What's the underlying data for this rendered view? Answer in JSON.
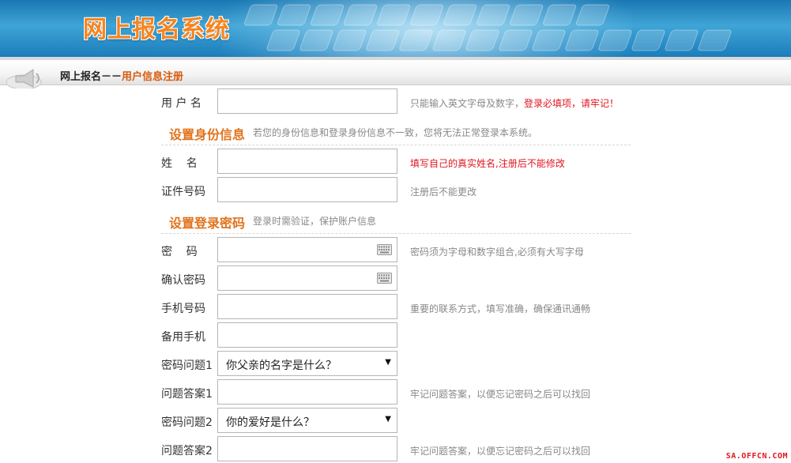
{
  "header": {
    "logo_text": "网上报名系统"
  },
  "breadcrumb": {
    "root": "网上报名－－",
    "current": "用户信息注册"
  },
  "form": {
    "username": {
      "label": "用 户 名",
      "hint": "只能输入英文字母及数字，",
      "hint_red": "登录必填项，请牢记！"
    },
    "identity_section": {
      "title": "设置身份信息",
      "note": "若您的身份信息和登录身份信息不一致，您将无法正常登录本系统。"
    },
    "name": {
      "label": "姓    名",
      "hint": "填写自己的真实姓名,注册后不能修改"
    },
    "id_number": {
      "label": "证件号码",
      "hint": "注册后不能更改"
    },
    "password_section": {
      "title": "设置登录密码",
      "note": "登录时需验证，保护账户信息"
    },
    "password": {
      "label": "密    码",
      "hint": "密码须为字母和数字组合,必须有大写字母"
    },
    "confirm_password": {
      "label": "确认密码"
    },
    "phone": {
      "label": "手机号码",
      "hint": "重要的联系方式，填写准确，确保通讯通畅"
    },
    "backup_phone": {
      "label": "备用手机"
    },
    "question1": {
      "label": "密码问题1",
      "value": "你父亲的名字是什么？"
    },
    "answer1": {
      "label": "问题答案1",
      "hint": "牢记问题答案，以便忘记密码之后可以找回"
    },
    "question2": {
      "label": "密码问题2",
      "value": "你的爱好是什么？"
    },
    "answer2": {
      "label": "问题答案2",
      "hint": "牢记问题答案，以便忘记密码之后可以找回"
    }
  },
  "watermark": "SA.OFFCN.COM",
  "colors": {
    "accent_orange": "#e0731c",
    "required_red": "#e0161f",
    "banner_blue": "#1b7dbb"
  },
  "icons": {
    "keyboard": "keyboard-icon",
    "dropdown": "chevron-down-icon",
    "speaker": "speaker-icon"
  }
}
